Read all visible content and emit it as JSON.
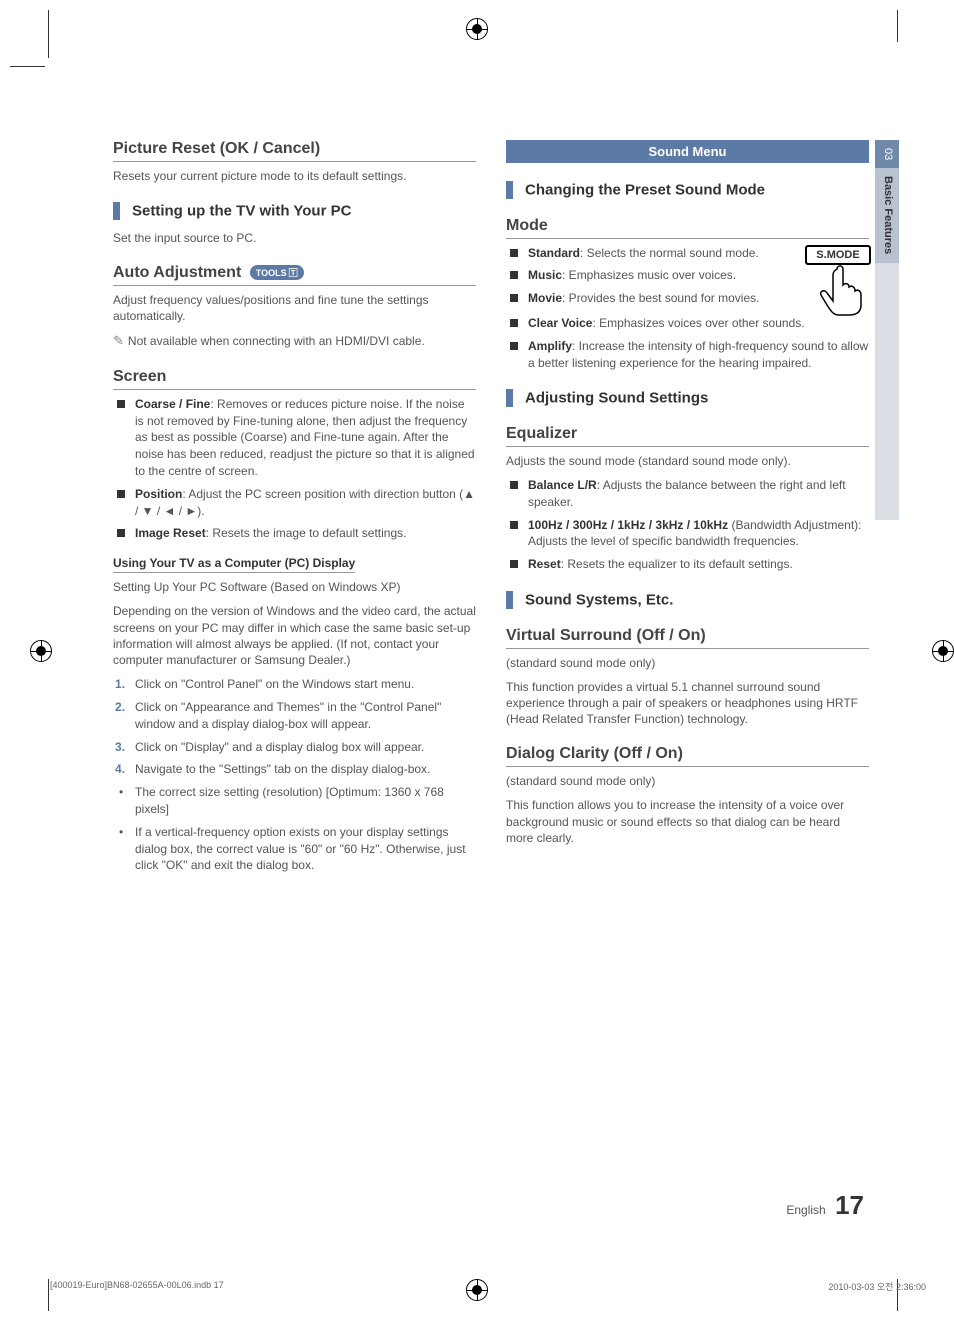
{
  "tab": {
    "num": "03",
    "label": "Basic Features"
  },
  "left": {
    "picture_reset_title": "Picture Reset (OK / Cancel)",
    "picture_reset_desc": "Resets your current picture mode to its default settings.",
    "setup_pc_header": "Setting up the TV with Your PC",
    "setup_pc_desc": "Set the input source to PC.",
    "auto_adj_title": "Auto Adjustment",
    "tools_badge": "TOOLS",
    "auto_adj_desc": "Adjust frequency values/positions and fine tune the settings automatically.",
    "auto_adj_note": "Not available when connecting with an HDMI/DVI cable.",
    "screen_title": "Screen",
    "screen_items": [
      {
        "label": "Coarse / Fine",
        "desc": ": Removes or reduces picture noise. If the noise is not removed by Fine-tuning alone, then adjust the frequency as best as possible (Coarse) and Fine-tune again. After the noise has been reduced, readjust the picture so that it is aligned to the centre of screen."
      },
      {
        "label": "Position",
        "desc": ": Adjust the PC screen position with direction button (▲ / ▼ / ◄ / ►)."
      },
      {
        "label": "Image Reset",
        "desc": ": Resets the image to default settings."
      }
    ],
    "pc_display_heading": "Using Your TV as a Computer (PC) Display",
    "pc_display_sub": "Setting Up Your PC Software (Based on Windows XP)",
    "pc_display_desc": "Depending on the version of Windows and the video card, the actual screens on your PC may differ in which case the same basic set-up information will almost always be applied. (If not, contact your computer manufacturer or Samsung Dealer.)",
    "steps": [
      "Click on \"Control Panel\" on the Windows start menu.",
      "Click on \"Appearance and Themes\" in the \"Control Panel\" window and a display dialog-box will appear.",
      "Click on \"Display\" and a display dialog box will appear.",
      "Navigate to the \"Settings\" tab on the display dialog-box."
    ],
    "sub_bullets": [
      "The correct size setting (resolution) [Optimum: 1360 x 768 pixels]",
      "If a vertical-frequency option exists on your display settings dialog box, the correct value is \"60\" or \"60 Hz\". Otherwise, just click \"OK\" and exit the dialog box."
    ]
  },
  "right": {
    "band": "Sound Menu",
    "changing_header": "Changing the Preset Sound Mode",
    "mode_title": "Mode",
    "smode_label": "S.MODE",
    "mode_items": [
      {
        "label": "Standard",
        "desc": ": Selects the normal sound mode."
      },
      {
        "label": "Music",
        "desc": ": Emphasizes music over voices."
      },
      {
        "label": "Movie",
        "desc": ": Provides the best sound for movies."
      },
      {
        "label": "Clear Voice",
        "desc": ": Emphasizes voices over other sounds."
      },
      {
        "label": "Amplify",
        "desc": ": Increase the intensity of high-frequency sound to allow a better listening experience for the hearing impaired."
      }
    ],
    "adjusting_header": "Adjusting Sound Settings",
    "eq_title": "Equalizer",
    "eq_desc": "Adjusts the sound mode (standard sound mode only).",
    "eq_items": [
      {
        "label": "Balance L/R",
        "desc": ": Adjusts the balance between the right and left speaker."
      },
      {
        "label": "100Hz / 300Hz / 1kHz / 3kHz / 10kHz",
        "desc": " (Bandwidth Adjustment): Adjusts the level of specific bandwidth frequencies."
      },
      {
        "label": "Reset",
        "desc": ": Resets the equalizer to its default settings."
      }
    ],
    "sound_systems_header": "Sound Systems, Etc.",
    "vs_title": "Virtual Surround (Off / On)",
    "vs_sub": "(standard sound mode only)",
    "vs_desc": "This function provides a virtual 5.1 channel surround sound experience through a pair of speakers or headphones using HRTF (Head Related Transfer Function) technology.",
    "dc_title": "Dialog Clarity (Off / On)",
    "dc_sub": "(standard sound mode only)",
    "dc_desc": "This function allows you to increase the intensity of a voice over background music or sound effects so that dialog can be heard more clearly."
  },
  "footer": {
    "lang": "English",
    "page": "17",
    "print_left": "[400019-Euro]BN68-02655A-00L06.indb   17",
    "print_right": "2010-03-03   오전 2:36:00"
  }
}
